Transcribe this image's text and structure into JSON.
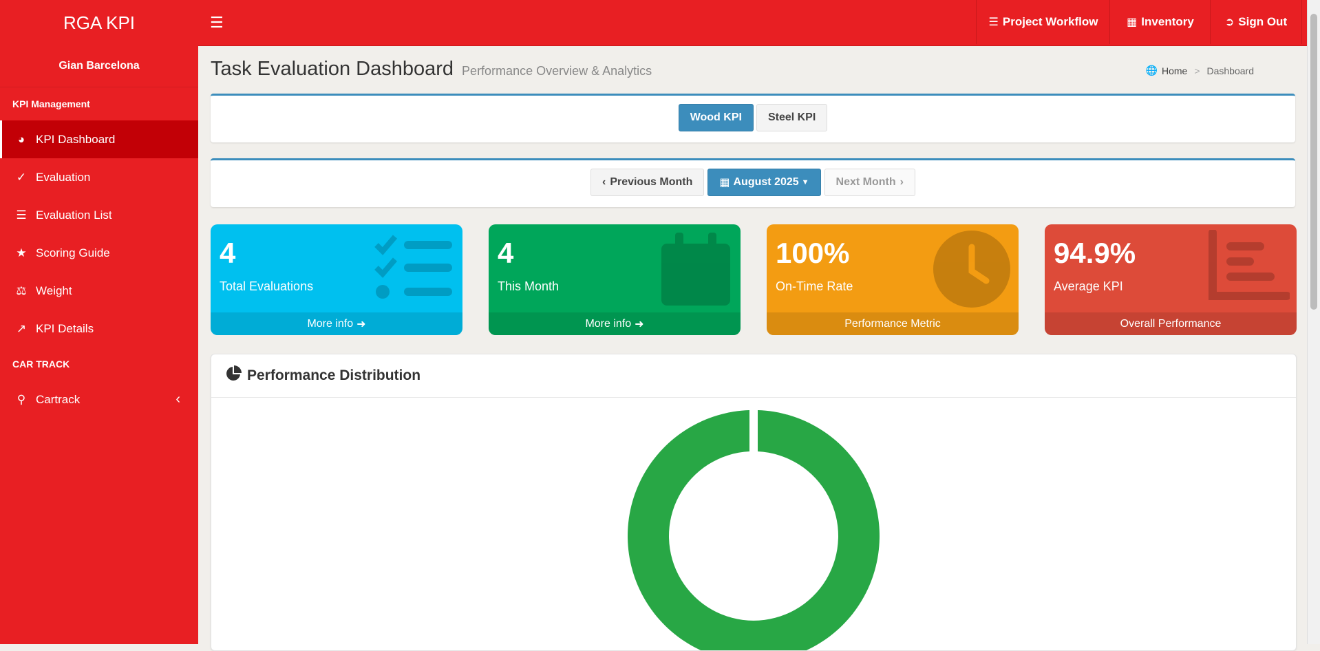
{
  "app": {
    "brand": "RGA KPI"
  },
  "topnav": {
    "project_workflow": "Project Workflow",
    "inventory": "Inventory",
    "sign_out": "Sign Out"
  },
  "sidebar": {
    "user_name": "Gian Barcelona",
    "section_kpi": "KPI Management",
    "items": [
      {
        "label": "KPI Dashboard",
        "icon": "dashboard-icon"
      },
      {
        "label": "Evaluation",
        "icon": "check-icon"
      },
      {
        "label": "Evaluation List",
        "icon": "list-icon"
      },
      {
        "label": "Scoring Guide",
        "icon": "star-icon"
      },
      {
        "label": "Weight",
        "icon": "balance-icon"
      },
      {
        "label": "KPI Details",
        "icon": "line-chart-icon"
      }
    ],
    "section_car": "CAR TRACK",
    "cartrack": {
      "label": "Cartrack",
      "icon": "map-pin-icon"
    }
  },
  "header": {
    "title": "Task Evaluation Dashboard",
    "subtitle": "Performance Overview & Analytics",
    "breadcrumb_home": "Home",
    "breadcrumb_sep": ">",
    "breadcrumb_current": "Dashboard"
  },
  "kpi_tabs": {
    "wood": "Wood KPI",
    "steel": "Steel KPI",
    "active": "Wood KPI"
  },
  "month_nav": {
    "previous": "Previous Month",
    "current": "August 2025",
    "next": "Next Month"
  },
  "stats": [
    {
      "value": "4",
      "label": "Total Evaluations",
      "footer": "More info",
      "color": "#00c0ef"
    },
    {
      "value": "4",
      "label": "This Month",
      "footer": "More info",
      "color": "#00a65a"
    },
    {
      "value": "100%",
      "label": "On-Time Rate",
      "footer": "Performance Metric",
      "color": "#f39c12"
    },
    {
      "value": "94.9%",
      "label": "Average KPI",
      "footer": "Overall Performance",
      "color": "#dd4b39"
    }
  ],
  "distribution": {
    "title": "Performance Distribution",
    "chart_color": "#28a745"
  }
}
